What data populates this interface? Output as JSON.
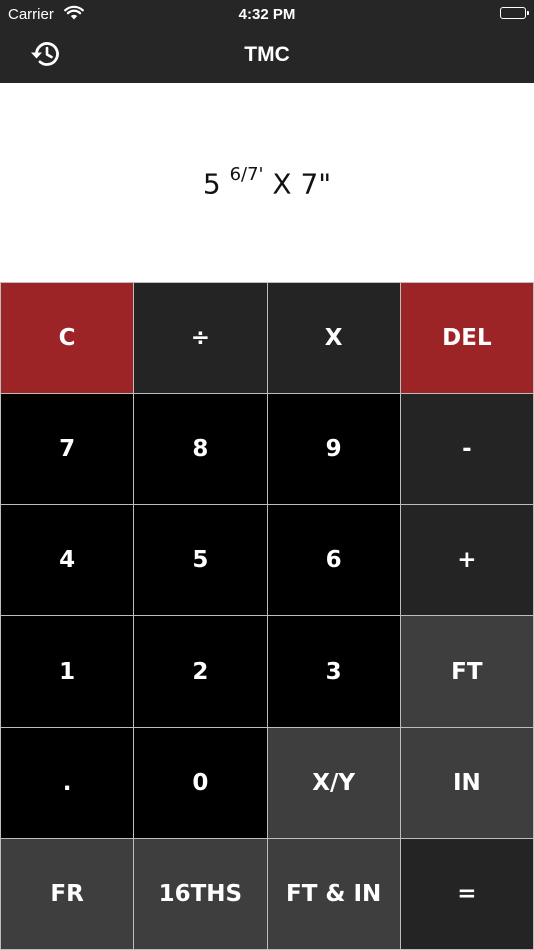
{
  "colors": {
    "bar": "#262626",
    "key_red": "#9d2426",
    "key_dark": "#242424",
    "key_black": "#000000",
    "key_gray": "#3e3e3e"
  },
  "status": {
    "carrier": "Carrier",
    "time": "4:32 PM"
  },
  "nav": {
    "title": "TMC",
    "history_icon": "history-icon"
  },
  "display": {
    "whole": "5",
    "fraction": "6/7",
    "fraction_unit": "'",
    "rest": "X 7\""
  },
  "keys": [
    {
      "label": "C",
      "style": "red"
    },
    {
      "label": "÷",
      "style": "dark"
    },
    {
      "label": "X",
      "style": "dark"
    },
    {
      "label": "DEL",
      "style": "red"
    },
    {
      "label": "7",
      "style": "black"
    },
    {
      "label": "8",
      "style": "black"
    },
    {
      "label": "9",
      "style": "black"
    },
    {
      "label": "-",
      "style": "dark"
    },
    {
      "label": "4",
      "style": "black"
    },
    {
      "label": "5",
      "style": "black"
    },
    {
      "label": "6",
      "style": "black"
    },
    {
      "label": "+",
      "style": "dark"
    },
    {
      "label": "1",
      "style": "black"
    },
    {
      "label": "2",
      "style": "black"
    },
    {
      "label": "3",
      "style": "black"
    },
    {
      "label": "FT",
      "style": "gray"
    },
    {
      "label": ".",
      "style": "black"
    },
    {
      "label": "0",
      "style": "black"
    },
    {
      "label": "X/Y",
      "style": "gray"
    },
    {
      "label": "IN",
      "style": "gray"
    },
    {
      "label": "FR",
      "style": "gray"
    },
    {
      "label": "16THS",
      "style": "gray"
    },
    {
      "label": "FT & IN",
      "style": "gray"
    },
    {
      "label": "=",
      "style": "dark"
    }
  ]
}
